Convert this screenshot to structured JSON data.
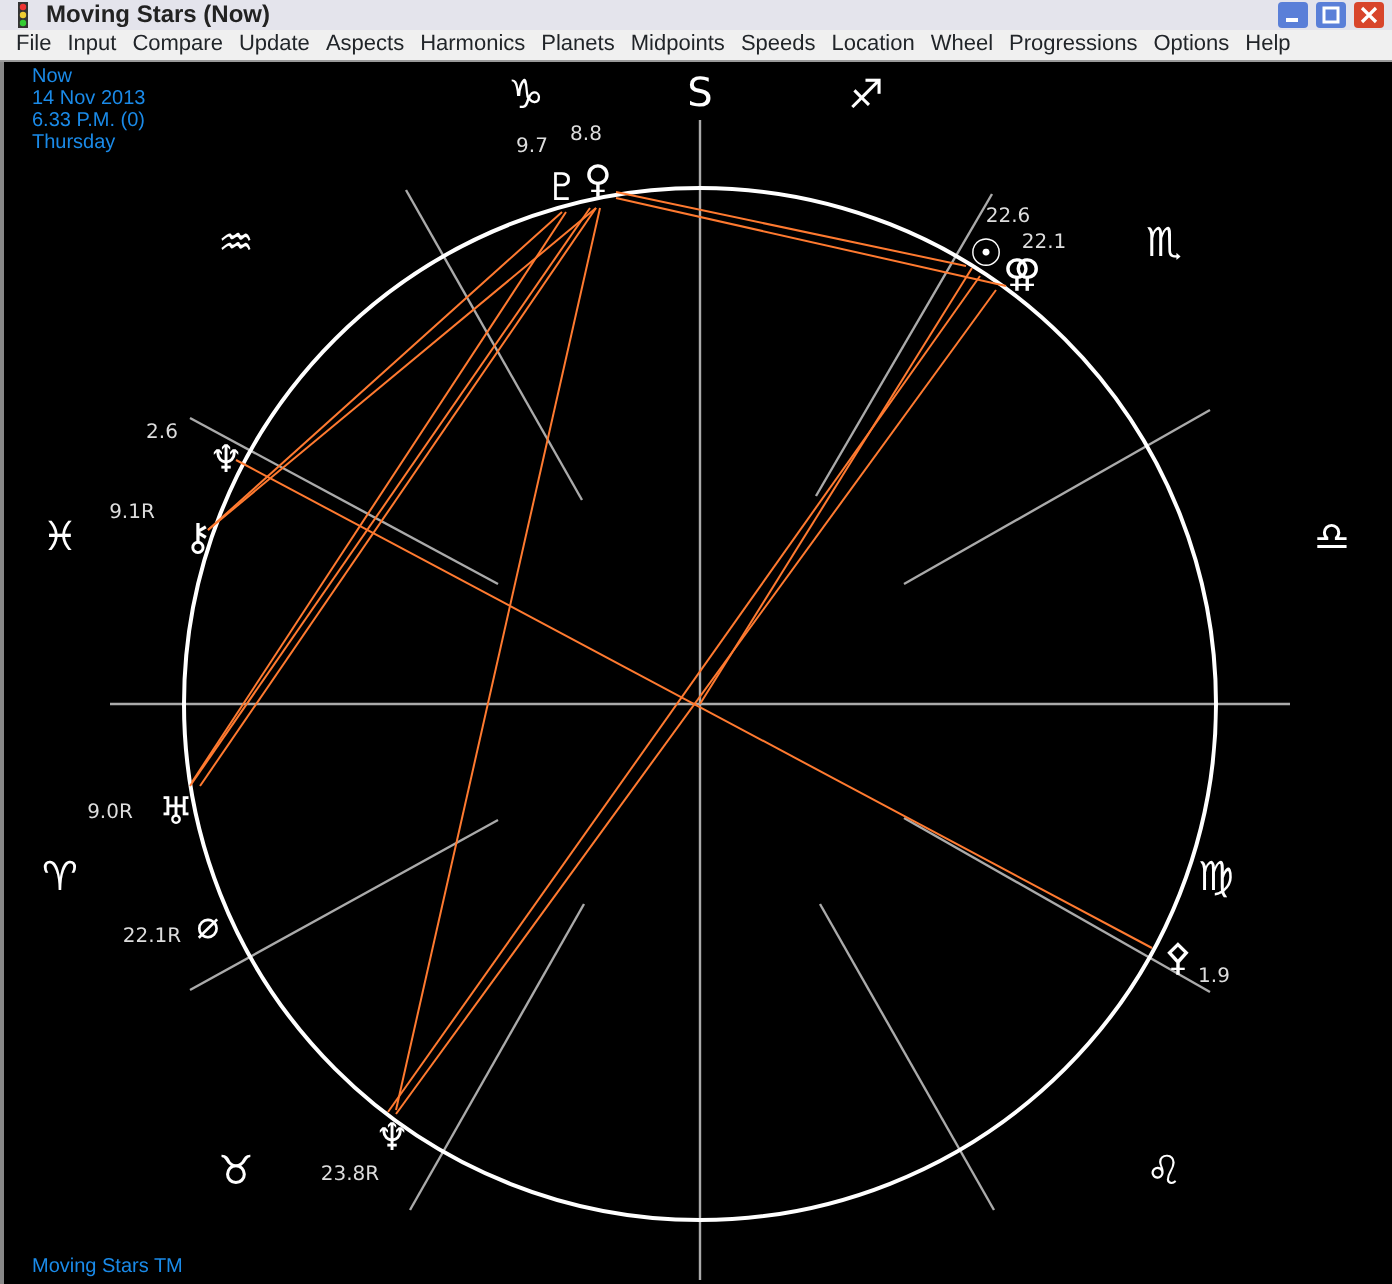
{
  "window": {
    "title": "Moving Stars (Now)"
  },
  "menu": [
    "File",
    "Input",
    "Compare",
    "Update",
    "Aspects",
    "Harmonics",
    "Planets",
    "Midpoints",
    "Speeds",
    "Location",
    "Wheel",
    "Progressions",
    "Options",
    "Help"
  ],
  "info": [
    "Now",
    "14 Nov 2013",
    "6.33 P.M. (0)",
    "Thursday"
  ],
  "chart": {
    "axis_label": "S",
    "signs": [
      "♑",
      "♐",
      "♏",
      "♎",
      "♍",
      "♌",
      "♉",
      "♈",
      "♓",
      "♒"
    ],
    "planets": [
      {
        "symbol": "♇",
        "reading": "9.7"
      },
      {
        "symbol": "♀",
        "reading": "8.8"
      },
      {
        "symbol": "☉",
        "reading": "22.6"
      },
      {
        "symbol": "⚢",
        "reading": "22.1"
      },
      {
        "symbol": "♆",
        "reading": "2.6"
      },
      {
        "symbol": "⚷",
        "reading": "9.1R"
      },
      {
        "symbol": "♅",
        "reading": "9.0R"
      },
      {
        "symbol": "⌀",
        "reading": "22.1R"
      },
      {
        "symbol": "♆",
        "reading": "23.8R"
      },
      {
        "symbol": "⚴",
        "reading": "1.9"
      }
    ]
  },
  "footer": "Moving Stars TM"
}
